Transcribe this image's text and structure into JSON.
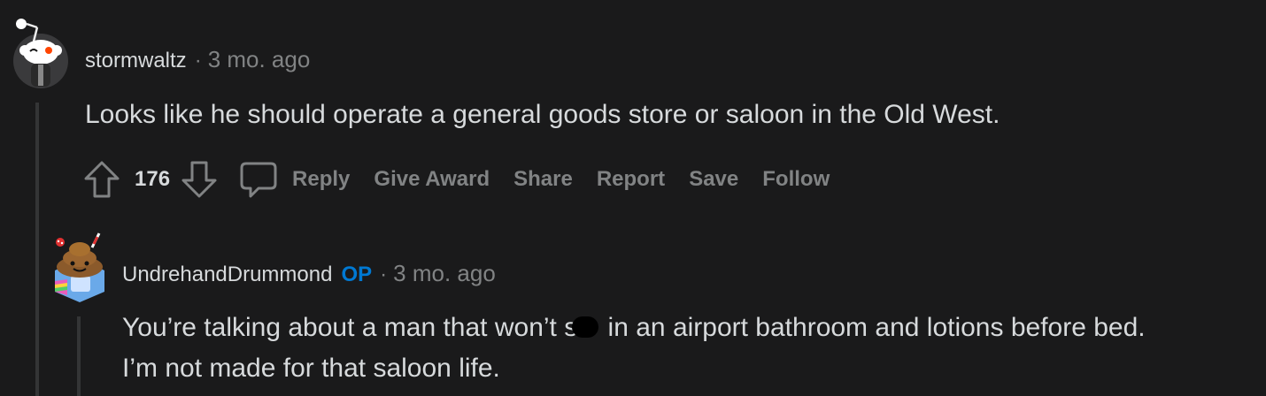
{
  "comments": [
    {
      "username": "stormwaltz",
      "separator": "·",
      "time": "3 mo. ago",
      "body": "Looks like he should operate a general goods store or saloon in the Old West.",
      "votes": "176",
      "actions": {
        "reply": "Reply",
        "give_award": "Give Award",
        "share": "Share",
        "report": "Report",
        "save": "Save",
        "follow": "Follow"
      },
      "icons": {
        "upvote": "arrow-up-outline-icon",
        "downvote": "arrow-down-outline-icon",
        "reply": "speech-bubble-icon"
      }
    },
    {
      "username": "UndrehandDrummond",
      "flair": "OP",
      "separator": "·",
      "time": "3 mo. ago",
      "body_line1_before": "You’re talking about a man that won’t s",
      "body_line1_after": " in an airport bathroom and lotions before bed.",
      "body_line2": "I’m not made for that saloon life."
    }
  ],
  "colors": {
    "background": "#1a1a1b",
    "text": "#d7dadc",
    "muted": "#818384",
    "op_blue": "#0079d3",
    "thread_line": "#343536"
  }
}
